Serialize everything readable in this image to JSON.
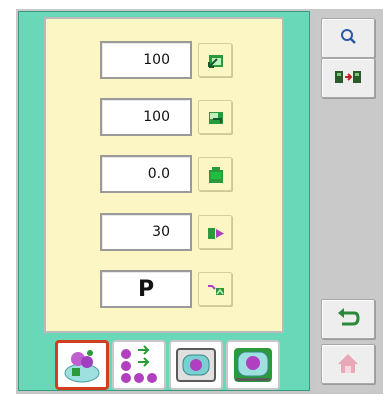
{
  "fields": [
    {
      "value": "100",
      "button_icon": "scale-horizontal-icon"
    },
    {
      "value": "100",
      "button_icon": "scale-vertical-icon"
    },
    {
      "value": "0.0",
      "button_icon": "rotate-angle-icon"
    },
    {
      "value": "30",
      "button_icon": "stitch-density-icon"
    },
    {
      "value": "P",
      "button_icon": "pattern-mode-icon"
    }
  ],
  "side_buttons": {
    "top": [
      "zoom-icon",
      "move-between-icon"
    ],
    "bottom": [
      "undo-back-icon",
      "home-icon"
    ]
  },
  "tabs": [
    {
      "icon": "embroidery-pattern-icon",
      "selected": true
    },
    {
      "icon": "pattern-arrange-icon",
      "selected": false
    },
    {
      "icon": "hoop-frame-icon",
      "selected": false
    },
    {
      "icon": "hoop-position-icon",
      "selected": false
    }
  ],
  "colors": {
    "panel": "#68d8b8",
    "inner": "#fbf6c4",
    "accent_green": "#2a9a3a",
    "accent_purple": "#b040c0",
    "selected_border": "#d04020"
  }
}
